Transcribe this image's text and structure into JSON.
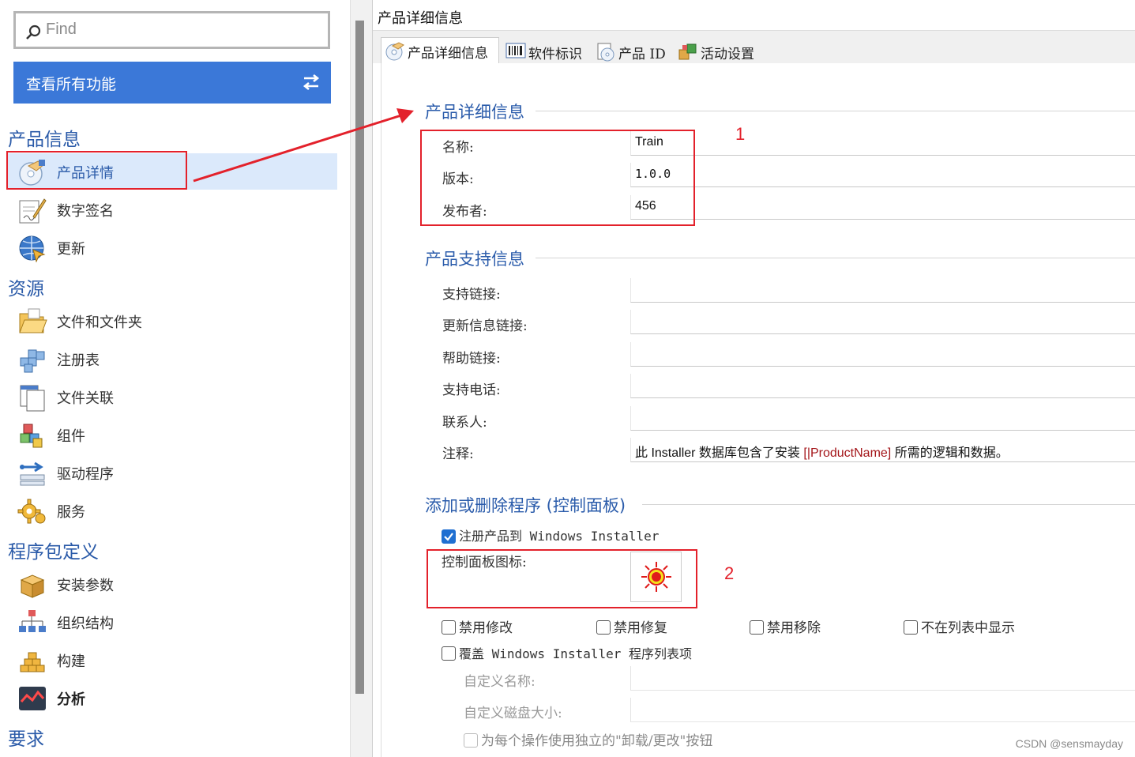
{
  "search": {
    "placeholder": "Find"
  },
  "all_features_button": "查看所有功能",
  "sections": {
    "product_info": {
      "title": "产品信息",
      "items": [
        "产品详情",
        "数字签名",
        "更新"
      ]
    },
    "resources": {
      "title": "资源",
      "items": [
        "文件和文件夹",
        "注册表",
        "文件关联",
        "组件",
        "驱动程序",
        "服务"
      ]
    },
    "package_definition": {
      "title": "程序包定义",
      "items": [
        "安装参数",
        "组织结构",
        "构建",
        "分析"
      ]
    },
    "requirements": {
      "title": "要求"
    }
  },
  "right": {
    "title": "产品详细信息",
    "tabs": [
      "产品详细信息",
      "软件标识",
      "产品 ID",
      "活动设置"
    ],
    "details_group": {
      "title": "产品详细信息",
      "fields": [
        {
          "label": "名称:",
          "value": "Train"
        },
        {
          "label": "版本:",
          "value": "1.0.0"
        },
        {
          "label": "发布者:",
          "value": "456"
        }
      ]
    },
    "support_group": {
      "title": "产品支持信息",
      "fields": [
        {
          "label": "支持链接:",
          "value": ""
        },
        {
          "label": "更新信息链接:",
          "value": ""
        },
        {
          "label": "帮助链接:",
          "value": ""
        },
        {
          "label": "支持电话:",
          "value": ""
        },
        {
          "label": "联系人:",
          "value": ""
        }
      ],
      "comment_label": "注释:",
      "comment_prefix": "此 Installer 数据库包含了安装 ",
      "comment_highlight": "[|ProductName]",
      "comment_suffix": " 所需的逻辑和数据。"
    },
    "addremove_group": {
      "title": "添加或删除程序 (控制面板)",
      "register_checkbox": "注册产品到 Windows Installer",
      "register_checked": true,
      "icon_label": "控制面板图标:",
      "options": [
        "禁用修改",
        "禁用修复",
        "禁用移除",
        "不在列表中显示"
      ],
      "override_checkbox": "覆盖 Windows Installer 程序列表项",
      "custom_name_label": "自定义名称:",
      "custom_size_label": "自定义磁盘大小:",
      "separate_button_checkbox": "为每个操作使用独立的\"卸载/更改\"按钮"
    }
  },
  "annotations": [
    "1",
    "2"
  ],
  "watermark": "CSDN @sensmayday",
  "colors": {
    "accent": "#3b78d8",
    "group_title": "#2b5cab",
    "annotation": "#e3212b",
    "selected_bg": "#dbe9fb"
  }
}
